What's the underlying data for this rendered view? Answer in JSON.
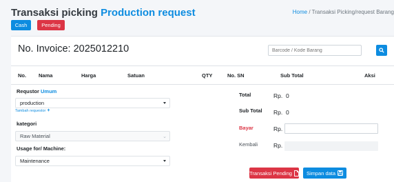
{
  "header": {
    "title_main": "Transaksi picking",
    "title_accent": "Production request",
    "breadcrumb": {
      "home": "Home",
      "separator": "/",
      "current": "Transaksi Picking/request Barang"
    },
    "buttons": {
      "cash": "Cash",
      "pending": "Pending"
    }
  },
  "invoice": {
    "label": "No. Invoice: 2025012210"
  },
  "search": {
    "placeholder": "Barcode / Kode Barang",
    "icon": "search-icon"
  },
  "table": {
    "columns": [
      "No.",
      "Nama",
      "Harga",
      "Satuan",
      "QTY",
      "No. SN",
      "Sub Total",
      "Aksi"
    ],
    "rows": []
  },
  "form": {
    "requestor": {
      "label": "Requstor",
      "label_accent": "Umum",
      "value": "production",
      "add_link": "Tambah requestor",
      "add_icon": "plus-icon"
    },
    "kategori": {
      "label": "kategori",
      "value": "Raw Material"
    },
    "usage": {
      "label": "Usage for/ Machine:",
      "value": "Maintenance"
    }
  },
  "summary": {
    "total": {
      "label": "Total",
      "currency": "Rp.",
      "value": "0"
    },
    "sub_total": {
      "label": "Sub Total",
      "currency": "Rp.",
      "value": "0"
    },
    "bayar": {
      "label": "Bayar",
      "currency": "Rp.",
      "value": ""
    },
    "kembali": {
      "label": "Kembali",
      "currency": "Rp.",
      "value": ""
    }
  },
  "actions": {
    "transaksi_pending": {
      "label": "Transaksi Pending",
      "icon": "file-icon"
    },
    "simpan": {
      "label": "Simpan data",
      "icon": "save-icon"
    }
  },
  "colors": {
    "primary": "#0d8ce0",
    "danger": "#dc3545",
    "page_bg": "#f4f6f9"
  }
}
